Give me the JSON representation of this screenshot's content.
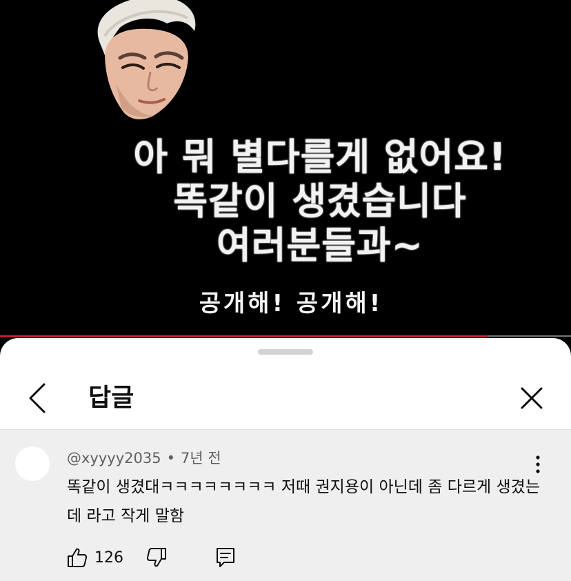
{
  "video": {
    "caption_lines": [
      "아 뭐 별다를게 없어요!",
      "똑같이 생겼습니다",
      "여러분들과~"
    ],
    "caption_sub": "공개해! 공개해!",
    "progress_fraction": 0.855,
    "progress_color": "#e8222e",
    "face_image": "man-with-bleached-hair-face"
  },
  "sheet": {
    "title": "답글",
    "back_icon": "chevron-left-icon",
    "close_icon": "close-icon"
  },
  "comment": {
    "author": "@xyyyy2035",
    "separator": "•",
    "time": "7년 전",
    "text": "똑같이 생겼대ㅋㅋㅋㅋㅋㅋㅋㅋ 저때 권지용이 아닌데 좀 다르게 생겼는데 라고 작게 말함",
    "like_count": "126",
    "icons": {
      "like": "thumbs-up-icon",
      "dislike": "thumbs-down-icon",
      "reply": "reply-icon",
      "more": "more-vertical-icon"
    }
  }
}
